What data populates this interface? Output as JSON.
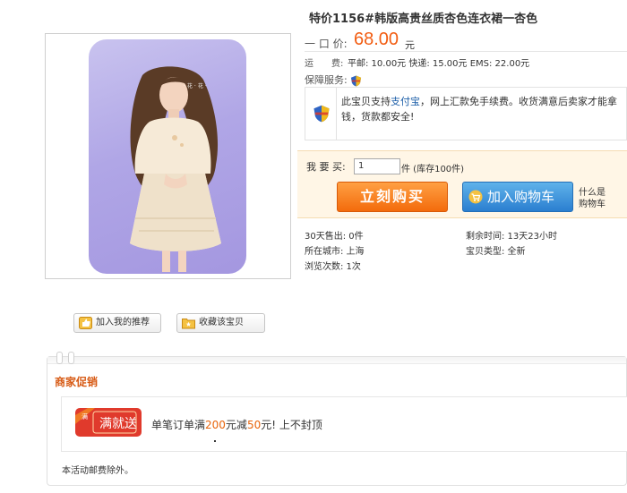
{
  "title": "特价1156#韩版高贵丝质杏色连衣裙一杏色",
  "product_image": {
    "deco_text": "·花·花·",
    "alt_icon": "dress-model-photo"
  },
  "price": {
    "label": "一 口 价:",
    "value": "68.00",
    "unit": "元"
  },
  "shipping": {
    "label": "运　　费:",
    "text": "平邮: 10.00元 快递: 15.00元 EMS: 22.00元"
  },
  "guarantee": {
    "label": "保障服务:"
  },
  "alipay": {
    "prefix": "此宝贝支持",
    "link": "支付宝",
    "suffix": "，网上汇款免手续费。收货满意后卖家才能拿钱，货款都安全!"
  },
  "buy": {
    "qty_label": "我 要 买:",
    "qty_value": "1",
    "qty_unit": "件  (库存100件)",
    "buy_now": "立刻购买",
    "add_to_cart": "加入购物车",
    "what_is_cart_line1": "什么是",
    "what_is_cart_line2": "购物车"
  },
  "stats": {
    "sold_30d": "30天售出: 0件",
    "remaining": "剩余时间: 13天23小时",
    "city": "所在城市: 上海",
    "item_type": "宝贝类型: 全新",
    "views": "浏览次数: 1次"
  },
  "actions": {
    "recommend": "加入我的推荐",
    "favorite": "收藏该宝贝"
  },
  "promo": {
    "title": "商家促销",
    "badge_small": "满",
    "badge_main": "满就送",
    "text_prefix": "单笔订单满",
    "amount1": "200",
    "text_mid": "元减",
    "amount2": "50",
    "text_suffix": "元! 上不封顶",
    "note": "本活动邮费除外。"
  },
  "colors": {
    "price": "#f25d12",
    "buy_button": "#f36b0c",
    "cart_button": "#2b7fd0",
    "promo_title": "#d75a14",
    "badge": "#e03a2c"
  }
}
